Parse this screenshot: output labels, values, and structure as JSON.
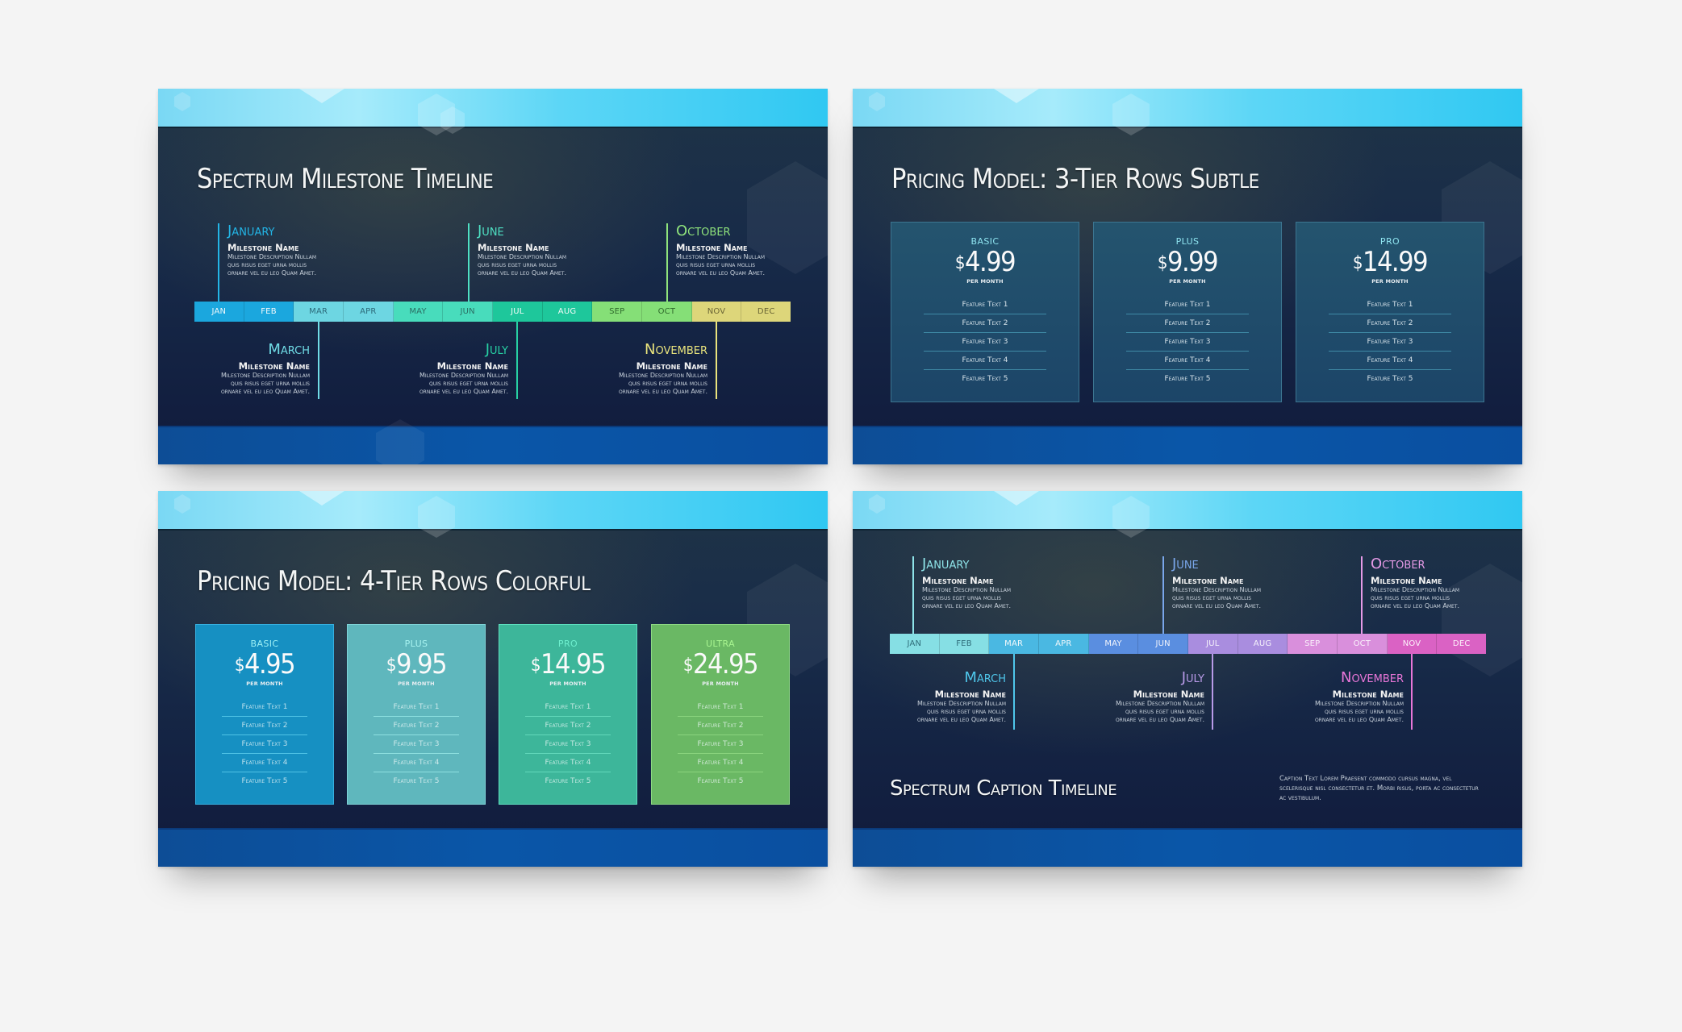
{
  "slides": [
    {
      "id": "milestone-timeline",
      "title": "Spectrum Milestone Timeline",
      "months": [
        {
          "label": "JAN",
          "bg": "#1ba7de",
          "fg": "#f2f8fb"
        },
        {
          "label": "FEB",
          "bg": "#1ba7de",
          "fg": "#f2f8fb"
        },
        {
          "label": "MAR",
          "bg": "#6dd6e2",
          "fg": "#2c6a7a"
        },
        {
          "label": "APR",
          "bg": "#6dd6e2",
          "fg": "#2c6a7a"
        },
        {
          "label": "MAY",
          "bg": "#48dcbc",
          "fg": "#2b6e63"
        },
        {
          "label": "JUN",
          "bg": "#48dcbc",
          "fg": "#2b6e63"
        },
        {
          "label": "JUL",
          "bg": "#1ec79b",
          "fg": "#f2fbf8"
        },
        {
          "label": "AUG",
          "bg": "#1ec79b",
          "fg": "#f2fbf8"
        },
        {
          "label": "SEP",
          "bg": "#85df77",
          "fg": "#2f6a2c"
        },
        {
          "label": "OCT",
          "bg": "#85df77",
          "fg": "#2f6a2c"
        },
        {
          "label": "NOV",
          "bg": "#ddd67a",
          "fg": "#6a6535"
        },
        {
          "label": "DEC",
          "bg": "#ddd67a",
          "fg": "#6a6535"
        }
      ],
      "milestones_top": [
        {
          "month": "January",
          "color": "#23b5e6",
          "name": "Milestone Name",
          "desc": "Milestone Description Nullam\nquis risus eget urna mollis\nornare vel eu leo Quam Amet."
        },
        {
          "month": "June",
          "color": "#4ee0c3",
          "name": "Milestone Name",
          "desc": "Milestone Description Nullam\nquis risus eget urna mollis\nornare vel eu leo Quam Amet."
        },
        {
          "month": "October",
          "color": "#8fe37c",
          "name": "Milestone Name",
          "desc": "Milestone Description Nullam\nquis risus eget urna mollis\nornare vel eu leo Quam Amet."
        }
      ],
      "milestones_bottom": [
        {
          "month": "March",
          "color": "#70dce6",
          "name": "Milestone Name",
          "desc": "Milestone Description Nullam\nquis risus eget urna mollis\nornare vel eu leo Quam Amet."
        },
        {
          "month": "July",
          "color": "#27cfa3",
          "name": "Milestone Name",
          "desc": "Milestone Description Nullam\nquis risus eget urna mollis\nornare vel eu leo Quam Amet."
        },
        {
          "month": "November",
          "color": "#e9e37c",
          "name": "Milestone Name",
          "desc": "Milestone Description Nullam\nquis risus eget urna mollis\nornare vel eu leo Quam Amet."
        }
      ]
    },
    {
      "id": "pricing-3-tier",
      "title": "Pricing Model: 3-Tier Rows Subtle",
      "tiers": [
        {
          "tier": "BASIC",
          "currency": "$",
          "price": "4.99",
          "per": "PER MONTH",
          "features": [
            "Feature Text 1",
            "Feature Text 2",
            "Feature Text 3",
            "Feature Text 4",
            "Feature Text 5"
          ]
        },
        {
          "tier": "PLUS",
          "currency": "$",
          "price": "9.99",
          "per": "PER MONTH",
          "features": [
            "Feature Text 1",
            "Feature Text 2",
            "Feature Text 3",
            "Feature Text 4",
            "Feature Text 5"
          ]
        },
        {
          "tier": "PRO",
          "currency": "$",
          "price": "14.99",
          "per": "PER MONTH",
          "features": [
            "Feature Text 1",
            "Feature Text 2",
            "Feature Text 3",
            "Feature Text 4",
            "Feature Text 5"
          ]
        }
      ],
      "tier_label_color": "#8fe4f0",
      "card_bg": "#1e4a6a",
      "card_border": "#3c7590",
      "separator": "#3f8aa6"
    },
    {
      "id": "pricing-4-tier",
      "title": "Pricing Model: 4-Tier Rows Colorful",
      "tiers": [
        {
          "tier": "BASIC",
          "currency": "$",
          "price": "4.95",
          "per": "PER MONTH",
          "bg": "#1690c2",
          "border": "#37b0e0",
          "label_color": "#9df0f5",
          "separator": "#4fc3e6",
          "features": [
            "Feature Text 1",
            "Feature Text 2",
            "Feature Text 3",
            "Feature Text 4",
            "Feature Text 5"
          ]
        },
        {
          "tier": "PLUS",
          "currency": "$",
          "price": "9.95",
          "per": "PER MONTH",
          "bg": "#5fb7bd",
          "border": "#80d4d8",
          "label_color": "#a8f3f0",
          "separator": "#8ee0e0",
          "features": [
            "Feature Text 1",
            "Feature Text 2",
            "Feature Text 3",
            "Feature Text 4",
            "Feature Text 5"
          ]
        },
        {
          "tier": "PRO",
          "currency": "$",
          "price": "14.95",
          "per": "PER MONTH",
          "bg": "#3db69a",
          "border": "#5fe0c0",
          "label_color": "#6ff0cf",
          "separator": "#62d8ba",
          "features": [
            "Feature Text 1",
            "Feature Text 2",
            "Feature Text 3",
            "Feature Text 4",
            "Feature Text 5"
          ]
        },
        {
          "tier": "ULTRA",
          "currency": "$",
          "price": "24.95",
          "per": "PER MONTH",
          "bg": "#6ab864",
          "border": "#8fda84",
          "label_color": "#a8f590",
          "separator": "#8ad47e",
          "features": [
            "Feature Text 1",
            "Feature Text 2",
            "Feature Text 3",
            "Feature Text 4",
            "Feature Text 5"
          ]
        }
      ]
    },
    {
      "id": "caption-timeline",
      "caption_title": "Spectrum Caption Timeline",
      "caption_text": "Caption Text Lorem Praesent commodo cursus magna, vel scelerisque nisl consectetur et. Morbi risus, porta ac consectetur ac vestibulum.",
      "months": [
        {
          "label": "JAN",
          "bg": "#86dfe4",
          "fg": "#2f6d7a"
        },
        {
          "label": "FEB",
          "bg": "#86dfe4",
          "fg": "#2f6d7a"
        },
        {
          "label": "MAR",
          "bg": "#4ab8e2",
          "fg": "#f2f8fb"
        },
        {
          "label": "APR",
          "bg": "#4ab8e2",
          "fg": "#f2f8fb"
        },
        {
          "label": "MAY",
          "bg": "#5a8ee0",
          "fg": "#f2f4fb"
        },
        {
          "label": "JUN",
          "bg": "#5a8ee0",
          "fg": "#f2f4fb"
        },
        {
          "label": "JUL",
          "bg": "#a98ddf",
          "fg": "#f6f2fb"
        },
        {
          "label": "AUG",
          "bg": "#a98ddf",
          "fg": "#f6f2fb"
        },
        {
          "label": "SEP",
          "bg": "#d98fdc",
          "fg": "#faf2fb"
        },
        {
          "label": "OCT",
          "bg": "#d98fdc",
          "fg": "#faf2fb"
        },
        {
          "label": "NOV",
          "bg": "#da62c4",
          "fg": "#fdf2fb"
        },
        {
          "label": "DEC",
          "bg": "#da62c4",
          "fg": "#fdf2fb"
        }
      ],
      "milestones_top": [
        {
          "month": "January",
          "color": "#8ee3e8",
          "name": "Milestone Name",
          "desc": "Milestone Description Nullam\nquis risus eget urna mollis\nornare vel eu leo Quam Amet."
        },
        {
          "month": "June",
          "color": "#7aa6ea",
          "name": "Milestone Name",
          "desc": "Milestone Description Nullam\nquis risus eget urna mollis\nornare vel eu leo Quam Amet."
        },
        {
          "month": "October",
          "color": "#e59ae6",
          "name": "Milestone Name",
          "desc": "Milestone Description Nullam\nquis risus eget urna mollis\nornare vel eu leo Quam Amet."
        }
      ],
      "milestones_bottom": [
        {
          "month": "March",
          "color": "#4fc6ea",
          "name": "Milestone Name",
          "desc": "Milestone Description Nullam\nquis risus eget urna mollis\nornare vel eu leo Quam Amet."
        },
        {
          "month": "July",
          "color": "#b89ae8",
          "name": "Milestone Name",
          "desc": "Milestone Description Nullam\nquis risus eget urna mollis\nornare vel eu leo Quam Amet."
        },
        {
          "month": "November",
          "color": "#e876d8",
          "name": "Milestone Name",
          "desc": "Milestone Description Nullam\nquis risus eget urna mollis\nornare vel eu leo Quam Amet."
        }
      ]
    }
  ]
}
